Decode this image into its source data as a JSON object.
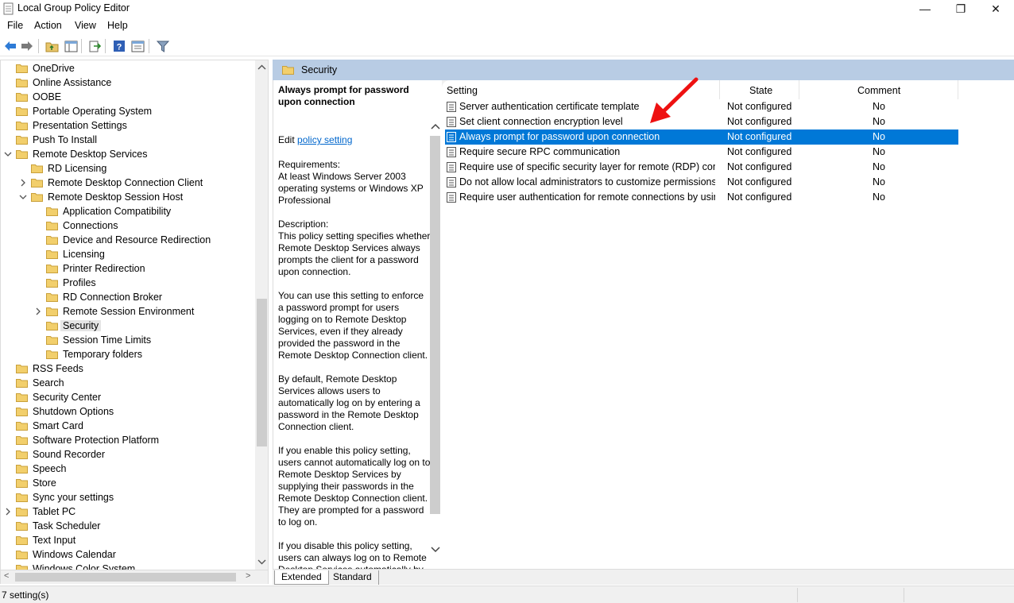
{
  "window": {
    "title": "Local Group Policy Editor",
    "min_glyph": "—",
    "max_glyph": "❐",
    "close_glyph": "✕"
  },
  "menu": [
    "File",
    "Action",
    "View",
    "Help"
  ],
  "toolbar": {
    "icons": [
      "back-arrow-icon",
      "forward-arrow-icon",
      "up-folder-icon",
      "show-hide-tree-icon",
      "export-list-icon",
      "help-icon",
      "properties-icon",
      "filter-icon"
    ]
  },
  "tree": {
    "items": [
      {
        "label": "OneDrive",
        "level": 0,
        "expander": ""
      },
      {
        "label": "Online Assistance",
        "level": 0,
        "expander": ""
      },
      {
        "label": "OOBE",
        "level": 0,
        "expander": ""
      },
      {
        "label": "Portable Operating System",
        "level": 0,
        "expander": ""
      },
      {
        "label": "Presentation Settings",
        "level": 0,
        "expander": ""
      },
      {
        "label": "Push To Install",
        "level": 0,
        "expander": ""
      },
      {
        "label": "Remote Desktop Services",
        "level": 0,
        "expander": "expanded"
      },
      {
        "label": "RD Licensing",
        "level": 1,
        "expander": ""
      },
      {
        "label": "Remote Desktop Connection Client",
        "level": 1,
        "expander": "collapsed"
      },
      {
        "label": "Remote Desktop Session Host",
        "level": 1,
        "expander": "expanded"
      },
      {
        "label": "Application Compatibility",
        "level": 2,
        "expander": ""
      },
      {
        "label": "Connections",
        "level": 2,
        "expander": ""
      },
      {
        "label": "Device and Resource Redirection",
        "level": 2,
        "expander": ""
      },
      {
        "label": "Licensing",
        "level": 2,
        "expander": ""
      },
      {
        "label": "Printer Redirection",
        "level": 2,
        "expander": ""
      },
      {
        "label": "Profiles",
        "level": 2,
        "expander": ""
      },
      {
        "label": "RD Connection Broker",
        "level": 2,
        "expander": ""
      },
      {
        "label": "Remote Session Environment",
        "level": 2,
        "expander": "collapsed"
      },
      {
        "label": "Security",
        "level": 2,
        "expander": "",
        "selected": true
      },
      {
        "label": "Session Time Limits",
        "level": 2,
        "expander": ""
      },
      {
        "label": "Temporary folders",
        "level": 2,
        "expander": ""
      },
      {
        "label": "RSS Feeds",
        "level": 0,
        "expander": ""
      },
      {
        "label": "Search",
        "level": 0,
        "expander": ""
      },
      {
        "label": "Security Center",
        "level": 0,
        "expander": ""
      },
      {
        "label": "Shutdown Options",
        "level": 0,
        "expander": ""
      },
      {
        "label": "Smart Card",
        "level": 0,
        "expander": ""
      },
      {
        "label": "Software Protection Platform",
        "level": 0,
        "expander": ""
      },
      {
        "label": "Sound Recorder",
        "level": 0,
        "expander": ""
      },
      {
        "label": "Speech",
        "level": 0,
        "expander": ""
      },
      {
        "label": "Store",
        "level": 0,
        "expander": ""
      },
      {
        "label": "Sync your settings",
        "level": 0,
        "expander": ""
      },
      {
        "label": "Tablet PC",
        "level": 0,
        "expander": "collapsed"
      },
      {
        "label": "Task Scheduler",
        "level": 0,
        "expander": ""
      },
      {
        "label": "Text Input",
        "level": 0,
        "expander": ""
      },
      {
        "label": "Windows Calendar",
        "level": 0,
        "expander": ""
      },
      {
        "label": "Windows Color System",
        "level": 0,
        "expander": ""
      }
    ]
  },
  "right_header": {
    "label": "Security"
  },
  "description": {
    "title": "Always prompt for password upon connection",
    "edit_prefix": "Edit ",
    "edit_link": "policy setting ",
    "requirements": "Requirements:\nAt least Windows Server 2003 operating systems or Windows XP Professional",
    "desc1": "Description:\nThis policy setting specifies whether Remote Desktop Services always prompts the client for a password upon connection.",
    "desc2": "You can use this setting to enforce a password prompt for users logging on to Remote Desktop Services, even if they already provided the password in the Remote Desktop Connection client.",
    "desc3": "By default, Remote Desktop Services allows users to automatically log on by entering a password in the Remote Desktop Connection client.",
    "desc4": "If you enable this policy setting, users cannot automatically log on to Remote Desktop Services by supplying their passwords in the Remote Desktop Connection client. They are prompted for a password to log on.",
    "desc5": "If you disable this policy setting, users can always log on to Remote Desktop Services automatically by"
  },
  "list": {
    "headers": {
      "setting": "Setting",
      "state": "State",
      "comment": "Comment"
    },
    "rows": [
      {
        "setting": "Server authentication certificate template",
        "state": "Not configured",
        "comment": "No"
      },
      {
        "setting": "Set client connection encryption level",
        "state": "Not configured",
        "comment": "No"
      },
      {
        "setting": "Always prompt for password upon connection",
        "state": "Not configured",
        "comment": "No",
        "selected": true
      },
      {
        "setting": "Require secure RPC communication",
        "state": "Not configured",
        "comment": "No"
      },
      {
        "setting": "Require use of specific security layer for remote (RDP) conn...",
        "state": "Not configured",
        "comment": "No"
      },
      {
        "setting": "Do not allow local administrators to customize permissions",
        "state": "Not configured",
        "comment": "No"
      },
      {
        "setting": "Require user authentication for remote connections by usin...",
        "state": "Not configured",
        "comment": "No"
      }
    ]
  },
  "tabs": {
    "extended": "Extended",
    "standard": "Standard"
  },
  "status": {
    "text": "7 setting(s)"
  },
  "colors": {
    "selection": "#0078d7",
    "header_band": "#b8cce4",
    "annotation_arrow": "#ee1111"
  }
}
